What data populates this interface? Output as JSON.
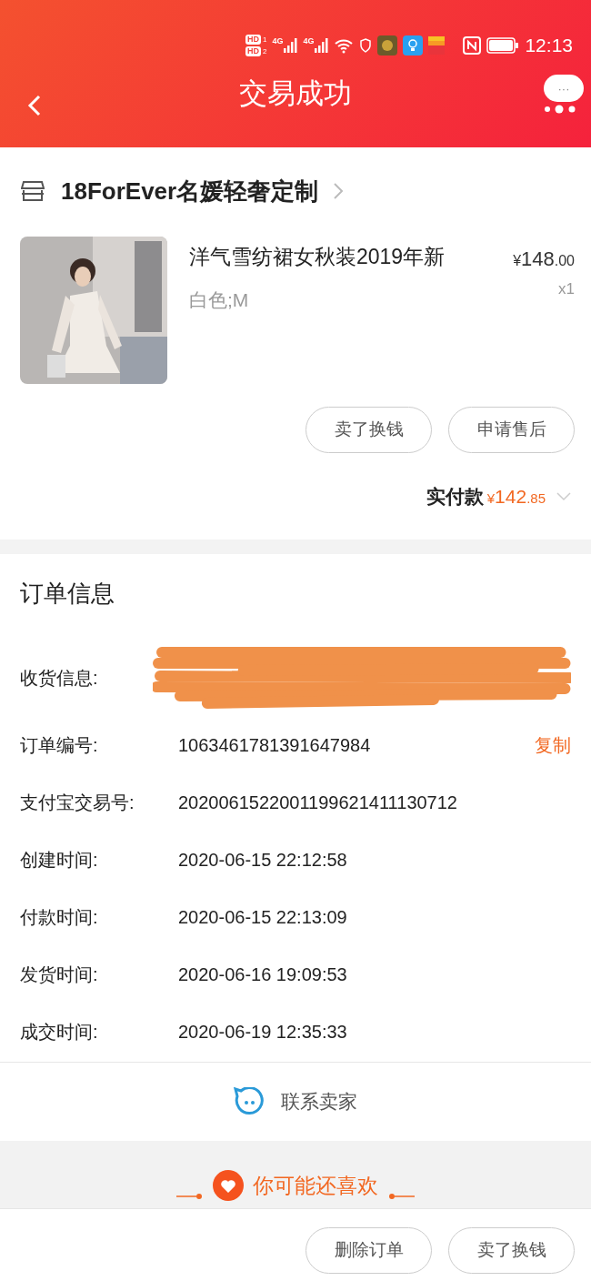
{
  "status_bar": {
    "sims": [
      {
        "badge": "HD",
        "slot": "1",
        "network": "4G"
      },
      {
        "badge": "HD",
        "slot": "2",
        "network": "4G"
      }
    ],
    "time": "12:13"
  },
  "header": {
    "title": "交易成功",
    "bubble": "···"
  },
  "store": {
    "name": "18ForEver名媛轻奢定制"
  },
  "product": {
    "kind": "picture",
    "title": "洋气雪纺裙女秋装2019年新",
    "sku": "白色;M",
    "currency": "¥",
    "price_int": "148",
    "price_dec": ".00",
    "qty": "x1"
  },
  "item_actions": [
    "卖了换钱",
    "申请售后"
  ],
  "payment": {
    "label": "实付款",
    "currency": "¥",
    "amount_int": "142",
    "amount_dec": ".85"
  },
  "order_info": {
    "title": "订单信息",
    "rows": [
      {
        "kind": "redacted",
        "label": "收货信息:"
      },
      {
        "kind": "copy",
        "label": "订单编号:",
        "value": "1063461781391647984",
        "action": "复制"
      },
      {
        "kind": "plain",
        "label": "支付宝交易号:",
        "value": "2020061522001199621411130712"
      },
      {
        "kind": "plain",
        "label": "创建时间:",
        "value": "2020-06-15 22:12:58"
      },
      {
        "kind": "plain",
        "label": "付款时间:",
        "value": "2020-06-15 22:13:09"
      },
      {
        "kind": "plain",
        "label": "发货时间:",
        "value": "2020-06-16 19:09:53"
      },
      {
        "kind": "plain",
        "label": "成交时间:",
        "value": "2020-06-19 12:35:33"
      }
    ]
  },
  "contact": {
    "label": "联系卖家"
  },
  "recommend": {
    "title": "你可能还喜欢"
  },
  "bottom_actions": [
    "删除订单",
    "卖了换钱"
  ]
}
